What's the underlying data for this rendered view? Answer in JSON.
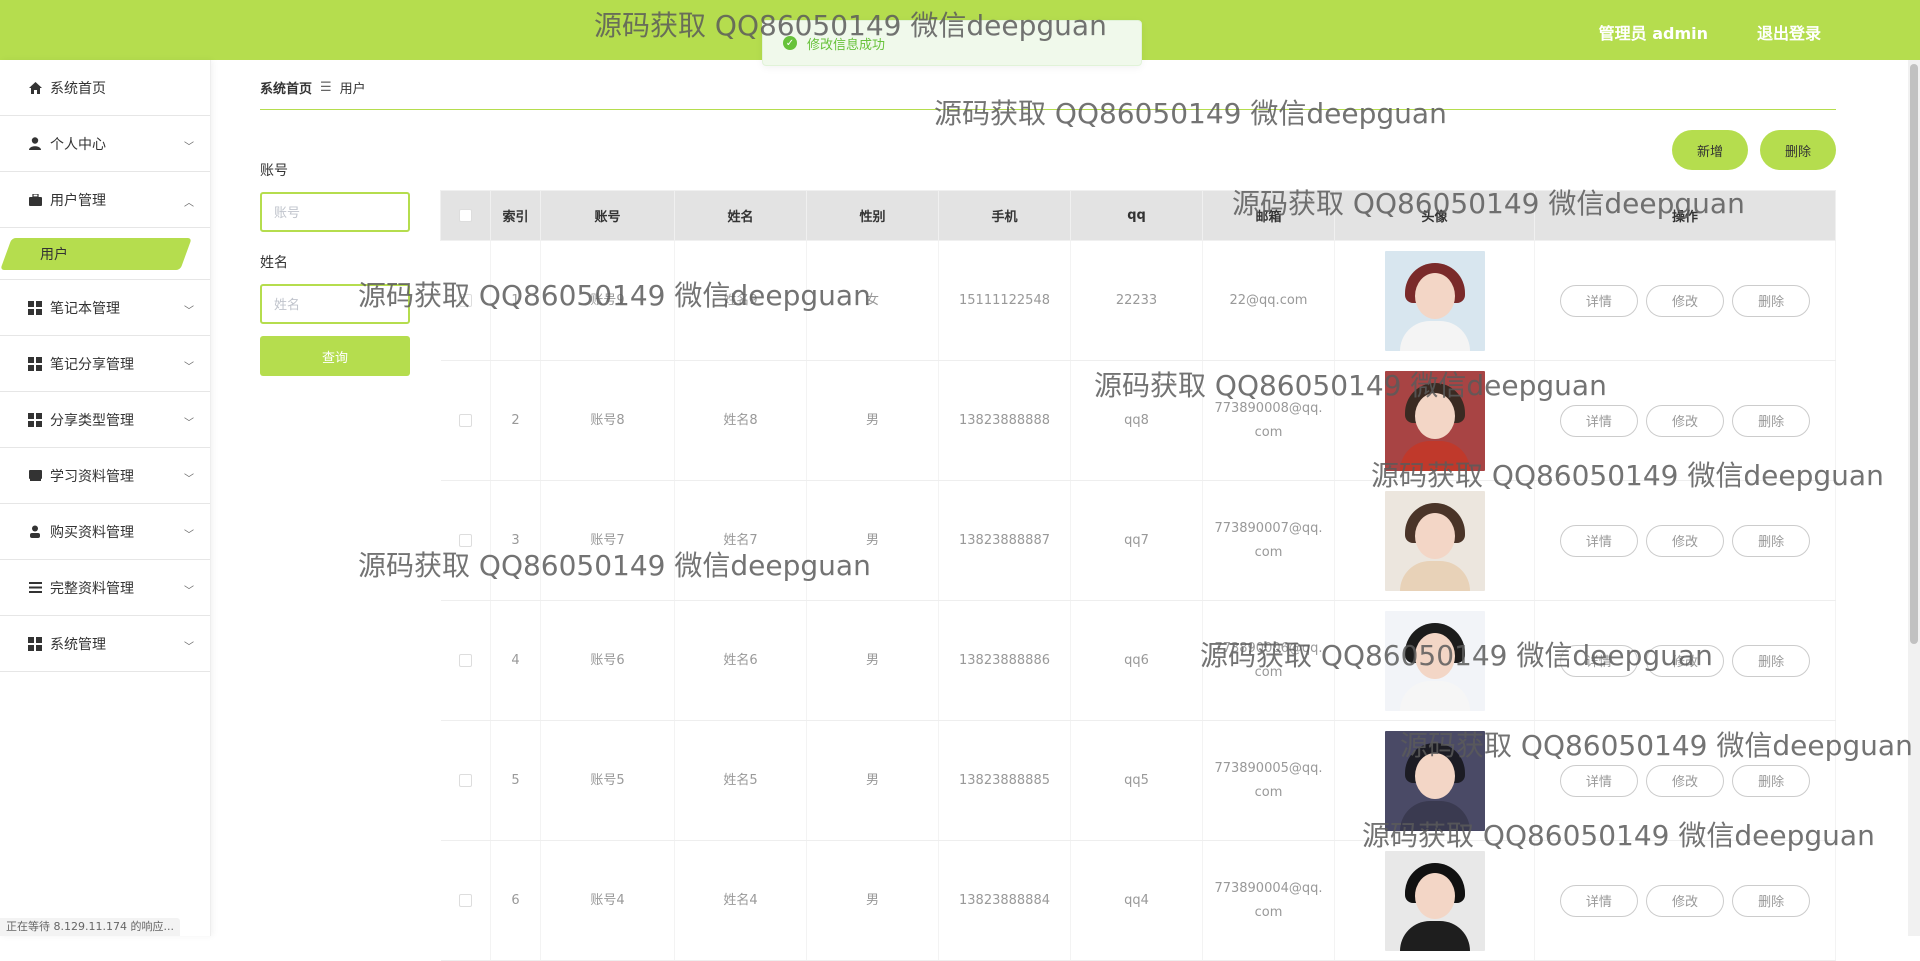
{
  "header": {
    "user_label": "管理员 admin",
    "logout_label": "退出登录",
    "bg_color": "#b5dd4e"
  },
  "toast": {
    "icon": "check-circle-icon",
    "message": "修改信息成功"
  },
  "sidebar": {
    "items": [
      {
        "label": "系统首页",
        "icon": "home-icon"
      },
      {
        "label": "个人中心",
        "icon": "user-icon"
      },
      {
        "label": "用户管理",
        "icon": "briefcase-icon",
        "expanded": true
      },
      {
        "label": "笔记本管理",
        "icon": "grid-icon"
      },
      {
        "label": "笔记分享管理",
        "icon": "grid-icon"
      },
      {
        "label": "分享类型管理",
        "icon": "grid-icon"
      },
      {
        "label": "学习资料管理",
        "icon": "book-icon"
      },
      {
        "label": "购买资料管理",
        "icon": "person-icon"
      },
      {
        "label": "完整资料管理",
        "icon": "list-icon"
      },
      {
        "label": "系统管理",
        "icon": "grid-icon"
      }
    ],
    "sub_item": "用户"
  },
  "breadcrumb": {
    "home": "系统首页",
    "current": "用户"
  },
  "search": {
    "account_label": "账号",
    "account_placeholder": "账号",
    "name_label": "姓名",
    "name_placeholder": "姓名",
    "query_label": "查询"
  },
  "actions": {
    "add_label": "新增",
    "delete_label": "删除"
  },
  "table": {
    "headers": [
      "索引",
      "账号",
      "姓名",
      "性别",
      "手机",
      "qq",
      "邮箱",
      "头像",
      "操作"
    ],
    "rows": [
      {
        "index": "1",
        "account": "账号9",
        "name": "姓名9",
        "gender": "女",
        "phone": "15111122548",
        "qq": "22233",
        "email": "22@qq.com",
        "avatar": "avatar-girl-red-headband"
      },
      {
        "index": "2",
        "account": "账号8",
        "name": "姓名8",
        "gender": "男",
        "phone": "13823888888",
        "qq": "qq8",
        "email": "773890008@qq.com",
        "avatar": "avatar-girl-red-jacket"
      },
      {
        "index": "3",
        "account": "账号7",
        "name": "姓名7",
        "gender": "男",
        "phone": "13823888887",
        "qq": "qq7",
        "email": "773890007@qq.com",
        "avatar": "avatar-girl-with-dog"
      },
      {
        "index": "4",
        "account": "账号6",
        "name": "姓名6",
        "gender": "男",
        "phone": "13823888886",
        "qq": "qq6",
        "email": "773890006@qq.com",
        "avatar": "avatar-boy-white-hoodie"
      },
      {
        "index": "5",
        "account": "账号5",
        "name": "姓名5",
        "gender": "男",
        "phone": "13823888885",
        "qq": "qq5",
        "email": "773890005@qq.com",
        "avatar": "avatar-girl-dark"
      },
      {
        "index": "6",
        "account": "账号4",
        "name": "姓名4",
        "gender": "男",
        "phone": "13823888884",
        "qq": "qq4",
        "email": "773890004@qq.com",
        "avatar": "avatar-boy-black-sweater"
      }
    ],
    "op_labels": {
      "detail": "详情",
      "edit": "修改",
      "delete": "删除"
    }
  },
  "watermark": "源码获取 QQ86050149 微信deepguan",
  "status_text": "正在等待 8.129.11.174 的响应..."
}
